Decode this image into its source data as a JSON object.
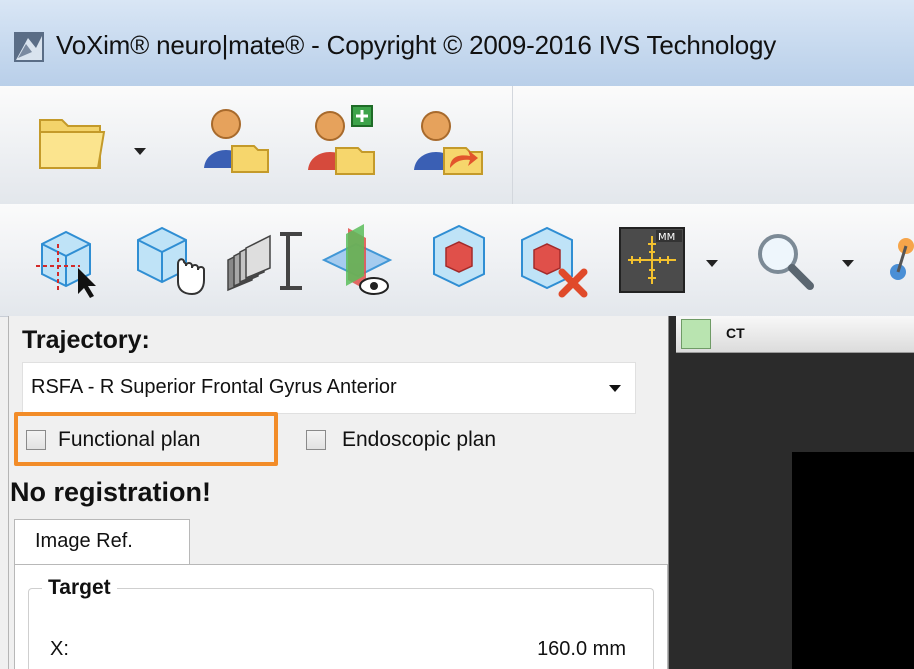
{
  "window": {
    "title": "VoXim® neuro|mate® - Copyright © 2009-2016  IVS Technology",
    "app_icon": "voxim-app-icon"
  },
  "toolbar_top": {
    "icons": [
      "folder-open-icon",
      "dropdown-arrow-icon",
      "patient-open-icon",
      "patient-add-icon",
      "patient-export-icon"
    ]
  },
  "toolbar_tools": {
    "icons": [
      "cube-crosshair-icon",
      "cube-hand-icon",
      "slice-stack-icon",
      "plane-eye-icon",
      "target-volume-icon",
      "target-remove-icon",
      "measure-mm-icon",
      "zoom-icon"
    ],
    "measure_badge": "MM"
  },
  "trajectory": {
    "label": "Trajectory:",
    "selected": "RSFA - R Superior Frontal Gyrus Anterior"
  },
  "options": {
    "functional_plan": {
      "label": "Functional plan",
      "checked": false
    },
    "endoscopic_plan": {
      "label": "Endoscopic plan",
      "checked": false
    }
  },
  "registration_status": "No registration!",
  "tabs": [
    {
      "label": "Image Ref."
    }
  ],
  "target": {
    "group_title": "Target",
    "x_label": "X:",
    "x_value": "160.0 mm"
  },
  "viewer": {
    "label": "CT"
  },
  "colors": {
    "highlight": "#f28c28",
    "titlebar": "#c5d8ee"
  }
}
